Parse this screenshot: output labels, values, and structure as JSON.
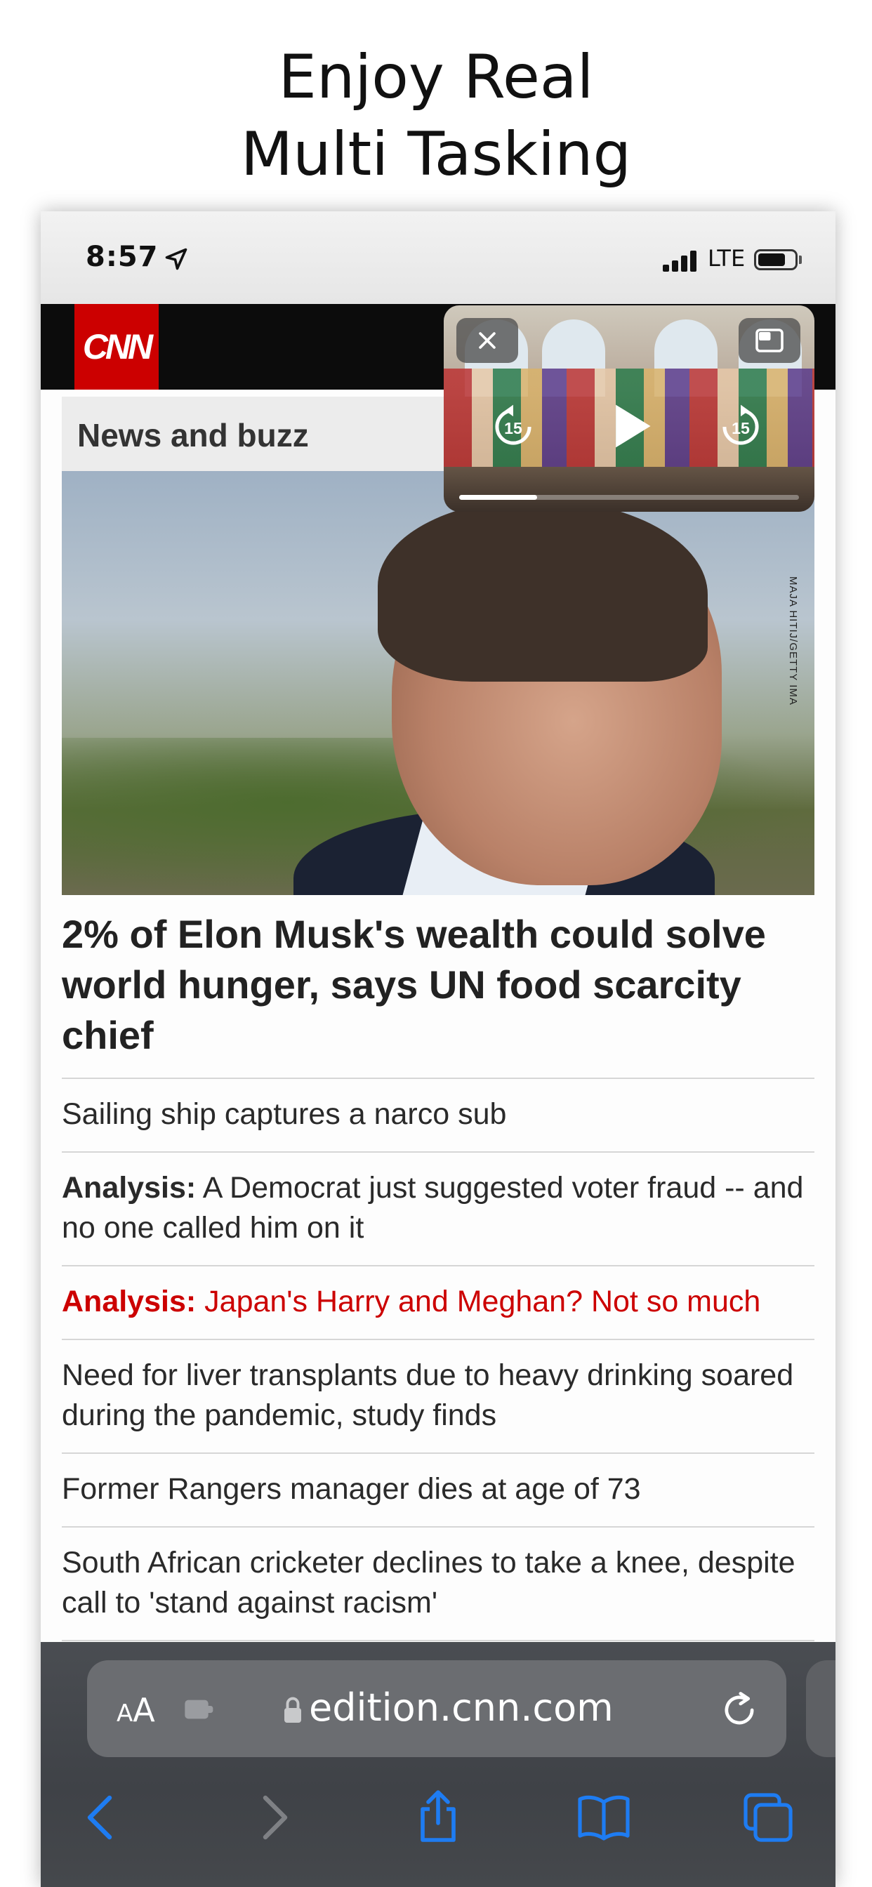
{
  "promo": {
    "line1": "Enjoy Real",
    "line2": "Multi Tasking"
  },
  "status_bar": {
    "time": "8:57",
    "network": "LTE",
    "battery_level": 0.76,
    "signal_bars": 4
  },
  "cnn": {
    "logo_text": "CNN",
    "section": "News and buzz",
    "photo_credit": "MAJA HITIJ/GETTY IMA",
    "top_story": "2% of Elon Musk's wealth could solve world hunger, says UN food scarcity chief",
    "stories": [
      {
        "prefix": "",
        "text": "Sailing ship captures a narco sub"
      },
      {
        "prefix": "Analysis:",
        "text": " A Democrat just suggested voter fraud -- and no one called him on it"
      },
      {
        "prefix": "Analysis:",
        "text": " Japan's Harry and Meghan? Not so much",
        "highlight": true
      },
      {
        "prefix": "",
        "text": "Need for liver transplants due to heavy drinking soared during the pandemic, study finds"
      },
      {
        "prefix": "",
        "text": "Former Rangers manager dies at age of 73"
      },
      {
        "prefix": "",
        "text": "South African cricketer declines to take a knee, despite call to 'stand against racism'"
      }
    ]
  },
  "pip": {
    "skip_back_seconds": "15",
    "skip_forward_seconds": "15",
    "progress": 0.23,
    "icons": [
      "close-icon",
      "pip-return-icon",
      "skip-back-icon",
      "play-icon",
      "skip-forward-icon"
    ]
  },
  "safari": {
    "text_size_small": "A",
    "text_size_big": "A",
    "url": "edition.cnn.com",
    "icons": [
      "back-icon",
      "forward-icon",
      "share-icon",
      "bookmarks-icon",
      "tabs-icon"
    ]
  },
  "colors": {
    "cnn_red": "#cc0000",
    "link_blue": "#1e7cf2",
    "highlight_red": "#cc0000"
  }
}
